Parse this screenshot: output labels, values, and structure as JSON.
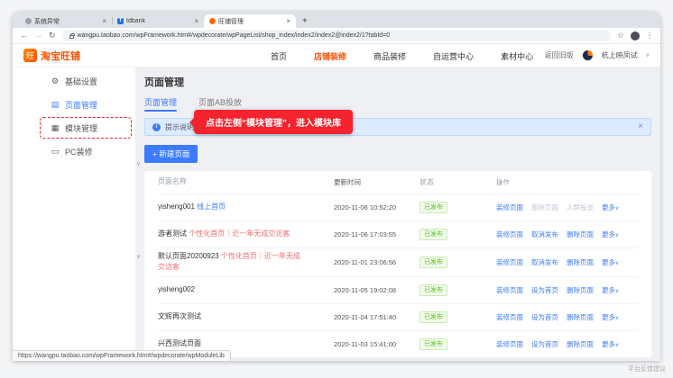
{
  "colors": {
    "accent_blue": "#3c7bff",
    "brand_red": "#ff5000",
    "annotation_red": "#f5232e",
    "status_green": "#52c41a"
  },
  "browser": {
    "tabs": [
      {
        "title": "系统异常",
        "favicon_style": "background:#9aa0a6;border-radius:50%"
      },
      {
        "title": "tdbank",
        "favicon_style": "background:#1a73e8",
        "favicon_letter": "T"
      },
      {
        "title": "旺铺管理",
        "favicon_style": "background:#ff6a00;border-radius:50%"
      }
    ],
    "close_glyph": "×",
    "new_tab_label": "+",
    "icons": {
      "back": "←",
      "forward": "→",
      "reload": "↻",
      "star": "☆",
      "menu": "⋮"
    },
    "url": "wangpu.taobao.com/wpFramework.htm#/wpdecorate/wpPageList/shop_index/index2/index2@index2/1?tabId=0",
    "status_url": "https://wangpu.taobao.com/wpFramework.htm#/wpdecorate/wpModuleLib"
  },
  "header": {
    "brand_glyph": "旺",
    "brand": "淘宝旺铺",
    "nav": [
      {
        "label": "首页"
      },
      {
        "label": "店铺装修"
      },
      {
        "label": "商品装修"
      },
      {
        "label": "自运营中心"
      },
      {
        "label": "素材中心"
      }
    ],
    "back_to_old": "返回旧版",
    "shop_name": "杭上映凤试",
    "caret": "∨"
  },
  "sidebar": {
    "items": [
      {
        "label": "基础设置",
        "glyph": "⚙"
      },
      {
        "label": "页面管理",
        "glyph": "▤"
      },
      {
        "label": "模块管理",
        "glyph": "▦"
      },
      {
        "label": "PC装修",
        "glyph": "▭"
      }
    ]
  },
  "page": {
    "title": "页面管理",
    "tabs": [
      {
        "label": "页面管理"
      },
      {
        "label": "页面AB投放"
      }
    ],
    "banner": {
      "icon_glyph": "i",
      "text": "提示说明",
      "close_glyph": "×"
    },
    "annotation": "点击左侧“模块管理”，进入模块库",
    "new_page_button_label": "+ 新建页面",
    "expand_caret": "∨"
  },
  "table": {
    "columns": [
      "页面名称",
      "更新时间",
      "状态",
      "操作"
    ],
    "rows": [
      {
        "name_parts": [
          {
            "text": "yisheng001 ",
            "style": "plain"
          },
          {
            "text": "线上首页",
            "style": "blue"
          }
        ],
        "updated": "2020-11-06 10:52:20",
        "status": "已发布",
        "ops": [
          {
            "label": "装修页面"
          },
          {
            "label": "删除页面",
            "style": "disabled"
          },
          {
            "label": "人群投放",
            "style": "disabled"
          },
          {
            "label": "更多",
            "caret": true
          }
        ]
      },
      {
        "name_parts": [
          {
            "text": "游者测试 ",
            "style": "plain"
          },
          {
            "text": "个性化首页｜近一年无成交访客",
            "style": "red"
          }
        ],
        "updated": "2020-11-06 17:03:55",
        "status": "已发布",
        "ops": [
          {
            "label": "装修页面"
          },
          {
            "label": "取消发布"
          },
          {
            "label": "删除页面"
          },
          {
            "label": "更多",
            "caret": true
          }
        ]
      },
      {
        "name_parts": [
          {
            "text": "默认页面20200923 ",
            "style": "plain"
          },
          {
            "text": "个性化首页｜近一年无成交访客",
            "style": "red"
          }
        ],
        "updated": "2020-11-01 23:06:56",
        "status": "已发布",
        "ops": [
          {
            "label": "装修页面"
          },
          {
            "label": "取消发布"
          },
          {
            "label": "删除页面"
          },
          {
            "label": "更多",
            "caret": true
          }
        ]
      },
      {
        "name_parts": [
          {
            "text": "yisheng002",
            "style": "plain"
          }
        ],
        "updated": "2020-11-05 19:02:08",
        "status": "已发布",
        "ops": [
          {
            "label": "装修页面"
          },
          {
            "label": "设为首页"
          },
          {
            "label": "删除页面"
          },
          {
            "label": "更多",
            "caret": true
          }
        ]
      },
      {
        "name_parts": [
          {
            "text": "文辉再次测试",
            "style": "plain"
          }
        ],
        "updated": "2020-11-04 17:51:40",
        "status": "已发布",
        "ops": [
          {
            "label": "装修页面"
          },
          {
            "label": "设为首页"
          },
          {
            "label": "删除页面"
          },
          {
            "label": "更多",
            "caret": true
          }
        ]
      },
      {
        "name_parts": [
          {
            "text": "兴西测试页面",
            "style": "plain"
          }
        ],
        "updated": "2020-11-03 15:41:00",
        "status": "已发布",
        "ops": [
          {
            "label": "装修页面"
          },
          {
            "label": "设为首页"
          },
          {
            "label": "删除页面"
          },
          {
            "label": "更多",
            "caret": true
          }
        ]
      }
    ]
  },
  "misc": {
    "feedback_label": "平台反馈建议"
  }
}
